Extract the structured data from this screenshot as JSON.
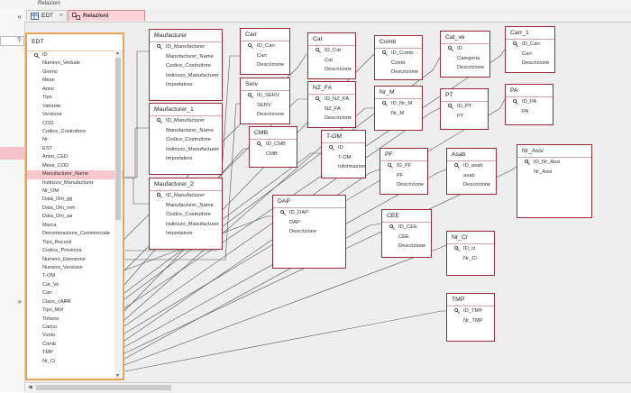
{
  "ribbon": {
    "label": "Relazioni"
  },
  "nav": {
    "collapse_icon": "«",
    "expand_icon": "»"
  },
  "tabs": [
    {
      "label": "EDT",
      "active": false
    },
    {
      "label": "Relazioni",
      "active": true
    }
  ],
  "edt": {
    "title": "EDT",
    "fields": [
      "ID",
      "Numero_Verbale",
      "Giorno",
      "Mese",
      "Anno",
      "Tipo",
      "Variante",
      "Versione",
      "COD",
      "Codice_Costruttore",
      "Nr",
      "EST",
      "Anno_CED",
      "Mese_COD",
      "Manufacturer_Name",
      "Indirizzo_Manufacturer",
      "Nr_OM",
      "Data_Om_gg",
      "Data_Om_mm",
      "Data_Om_aa",
      "Marca",
      "Denominazione_Commerciale",
      "Tipo_Record",
      "Codice_Provincia",
      "Numero_Etensione",
      "Numero_Versione",
      "T-OM",
      "Cat_Ve",
      "Carr",
      "Class_cARR",
      "Tipo_Mot",
      "Timone",
      "Carico",
      "Vuoto",
      "Comb",
      "TMP",
      "Nr_Ci"
    ],
    "selected": "Manufacturer_Name"
  },
  "tables": [
    {
      "id": "maufacturer",
      "title": "Maufacturer",
      "fields": [
        "ID_Manufacturer",
        "Manufacturer_Name",
        "Codice_Costruttore",
        "Indirizzo_Manufacturer",
        "Importatore"
      ]
    },
    {
      "id": "maufacturer_1",
      "title": "Maufacturer_1",
      "fields": [
        "ID_Manufacturer",
        "Manufacturer_Name",
        "Codice_Costruttore",
        "Indirizzo_Manufacturer",
        "Importatore"
      ]
    },
    {
      "id": "maufacturer_2",
      "title": "Maufacturer_2",
      "fields": [
        "ID_Manufacturer",
        "Manufacturer_Name",
        "Codice_Costruttore",
        "Indirizzo_Manufacturer",
        "Importatore"
      ]
    },
    {
      "id": "carr",
      "title": "Carr",
      "fields": [
        "ID_Carr",
        "Carr",
        "Descrizione"
      ]
    },
    {
      "id": "serv",
      "title": "Serv",
      "fields": [
        "ID_SERV",
        "SERV",
        "Descrizione"
      ]
    },
    {
      "id": "cmb",
      "title": "CMB",
      "fields": [
        "ID_CMB",
        "CMB"
      ]
    },
    {
      "id": "cat",
      "title": "Cat",
      "fields": [
        "ID_Cat",
        "Cat",
        "Descrizione"
      ]
    },
    {
      "id": "nz_fa",
      "title": "NZ_FA",
      "fields": [
        "ID_NZ_FA",
        "NZ_FA",
        "Descrizione"
      ]
    },
    {
      "id": "t_om",
      "title": "T-OM",
      "fields": [
        "ID",
        "T-OM",
        "Informazioni"
      ]
    },
    {
      "id": "comb",
      "title": "Comb",
      "fields": [
        "ID_Comb",
        "Comb",
        "Descrizione"
      ]
    },
    {
      "id": "nr_m",
      "title": "Nr_M",
      "fields": [
        "ID_Nr_M",
        "Nr_M"
      ]
    },
    {
      "id": "cat_ve",
      "title": "Cat_ve",
      "fields": [
        "ID",
        "Categoria",
        "Descrizione"
      ]
    },
    {
      "id": "pt",
      "title": "PT",
      "fields": [
        "ID_PT",
        "PT"
      ]
    },
    {
      "id": "carr_1",
      "title": "Carr_1",
      "fields": [
        "ID_Carr",
        "Carr",
        "Descrizione"
      ]
    },
    {
      "id": "pa",
      "title": "PA",
      "fields": [
        "ID_PA",
        "PA"
      ]
    },
    {
      "id": "pf",
      "title": "PF",
      "fields": [
        "ID_PF",
        "PF",
        "Descrizione"
      ]
    },
    {
      "id": "asab",
      "title": "Asab",
      "fields": [
        "ID_asab",
        "asab",
        "Descrizione"
      ]
    },
    {
      "id": "nr_assi",
      "title": "Nr_Assi",
      "fields": [
        "ID_Nr_Assi",
        "Nr_Assi"
      ]
    },
    {
      "id": "dap",
      "title": "DAP",
      "fields": [
        "ID_DAP",
        "DAP",
        "Descrizione"
      ]
    },
    {
      "id": "cee",
      "title": "CEE",
      "fields": [
        "ID_CEE",
        "CEE",
        "Descrizione"
      ]
    },
    {
      "id": "nr_ci",
      "title": "Nr_Ci",
      "fields": [
        "ID_ci",
        "Nr_Ci"
      ]
    },
    {
      "id": "tmp",
      "title": "TMP",
      "fields": [
        "ID_TMP",
        "Nr_TMP"
      ]
    }
  ]
}
